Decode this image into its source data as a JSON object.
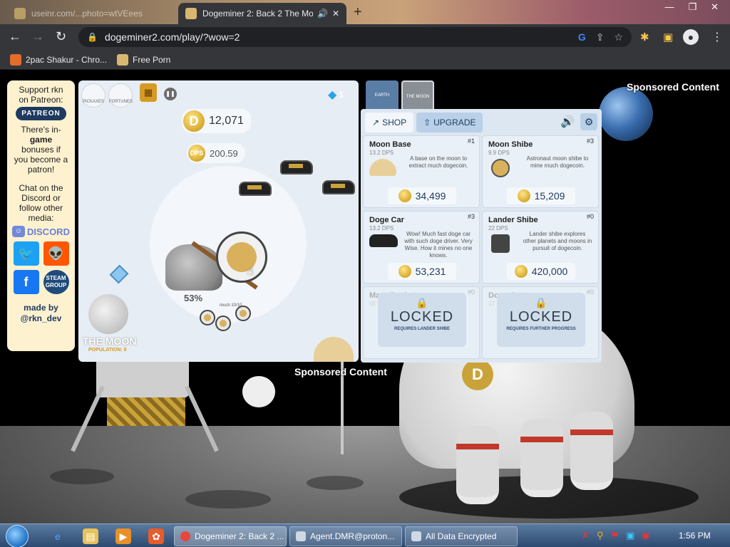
{
  "browser": {
    "tabs": [
      {
        "title": "useinr.com/...photo=wtVEees",
        "active": false
      },
      {
        "title": "Dogeminer 2: Back 2 The Mo",
        "active": true
      }
    ],
    "url": "dogeminer2.com/play/?wow=2",
    "bookmarks": [
      {
        "label": "2pac Shakur - Chro..."
      },
      {
        "label": "Free Porn"
      }
    ]
  },
  "page": {
    "sponsored_top": "Sponsored Content",
    "sponsored_bottom": "Sponsored Content"
  },
  "sidebar": {
    "support_line1": "Support rkn",
    "support_line2": "on Patreon:",
    "patreon_button": "PATREON",
    "bonus_line1": "There's in-",
    "bonus_line2": "game",
    "bonus_line3": "bonuses if",
    "bonus_line4": "you become a",
    "bonus_line5": "patron!",
    "chat_line1": "Chat on the",
    "chat_line2": "Discord or",
    "chat_line3": "follow other",
    "chat_line4": "media:",
    "discord_label": "DISCORD",
    "steam_label": "STEAM GROUP",
    "made_by_line1": "made by",
    "made_by_line2": "@rkn_dev"
  },
  "game": {
    "tool_labels": [
      "PICKAXES",
      "FORTUNES"
    ],
    "gems": "1",
    "coins": "12,071",
    "dps_label": "DPS",
    "dps": "200.59",
    "pick_progress": "53%",
    "pick_progress_value": 0.53,
    "small_label": "much 10/10",
    "moon_name": "THE MOON",
    "moon_population": "POPULATION: 8"
  },
  "planets": [
    {
      "label": "EARTH"
    },
    {
      "label": "THE MOON"
    }
  ],
  "shop": {
    "tab_shop": "SHOP",
    "tab_upgrade": "UPGRADE",
    "items": [
      {
        "name": "Moon Base",
        "count": "#1",
        "dps": "13.2 DPS",
        "desc": "A base on the moon to extract much dogecoin.",
        "price": "34,499"
      },
      {
        "name": "Moon Shibe",
        "count": "#3",
        "dps": "9.9 DPS",
        "desc": "Astronaut moon shibe to mine much dogecoin.",
        "price": "15,209"
      },
      {
        "name": "Doge Car",
        "count": "#3",
        "dps": "13.2 DPS",
        "desc": "Wow! Much fast doge car with such doge driver. Very Wise. How it mines no one knows.",
        "price": "53,231"
      },
      {
        "name": "Lander Shibe",
        "count": "#0",
        "dps": "22 DPS",
        "desc": "Lander shibe explores other planets and moons in pursuit of dogecoin.",
        "price": "420,000"
      },
      {
        "name": "Mars Rocket",
        "count": "#0",
        "dps": "55",
        "locked": "LOCKED",
        "requirement": "REQUIRES LANDER SHIBE"
      },
      {
        "name": "Doge Gate",
        "count": "#0",
        "dps": "17",
        "locked": "LOCKED",
        "requirement": "REQUIRES FURTHER PROGRESS"
      }
    ]
  },
  "taskbar": {
    "windows": [
      {
        "label": "Dogeminer 2: Back 2 ...",
        "active": true
      },
      {
        "label": "Agent.DMR@proton...",
        "active": false
      },
      {
        "label": "All Data Encrypted",
        "active": false
      }
    ],
    "clock": "1:56 PM"
  }
}
